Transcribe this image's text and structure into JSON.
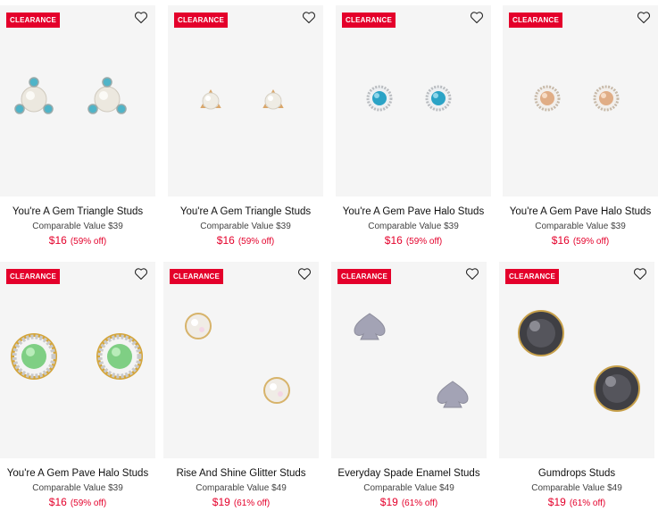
{
  "colors": {
    "accent": "#e4002b",
    "card_bg": "#f5f5f5"
  },
  "products": [
    {
      "badge": "CLEARANCE",
      "wishlist_icon": "heart-outline-icon",
      "name": "You're A Gem Triangle Studs",
      "comparable": "Comparable Value $39",
      "price": "$16",
      "discount": "(59% off)"
    },
    {
      "badge": "CLEARANCE",
      "wishlist_icon": "heart-outline-icon",
      "name": "You're A Gem Triangle Studs",
      "comparable": "Comparable Value $39",
      "price": "$16",
      "discount": "(59% off)"
    },
    {
      "badge": "CLEARANCE",
      "wishlist_icon": "heart-outline-icon",
      "name": "You're A Gem Pave Halo Studs",
      "comparable": "Comparable Value $39",
      "price": "$16",
      "discount": "(59% off)"
    },
    {
      "badge": "CLEARANCE",
      "wishlist_icon": "heart-outline-icon",
      "name": "You're A Gem Pave Halo Studs",
      "comparable": "Comparable Value $39",
      "price": "$16",
      "discount": "(59% off)"
    },
    {
      "badge": "CLEARANCE",
      "wishlist_icon": "heart-outline-icon",
      "name": "You're A Gem Pave Halo Studs",
      "comparable": "Comparable Value $39",
      "price": "$16",
      "discount": "(59% off)"
    },
    {
      "badge": "CLEARANCE",
      "wishlist_icon": "heart-outline-icon",
      "name": "Rise And Shine Glitter Studs",
      "comparable": "Comparable Value $49",
      "price": "$19",
      "discount": "(61% off)"
    },
    {
      "badge": "CLEARANCE",
      "wishlist_icon": "heart-outline-icon",
      "name": "Everyday Spade Enamel Studs",
      "comparable": "Comparable Value $49",
      "price": "$19",
      "discount": "(61% off)"
    },
    {
      "badge": "CLEARANCE",
      "wishlist_icon": "heart-outline-icon",
      "name": "Gumdrops Studs",
      "comparable": "Comparable Value $49",
      "price": "$19",
      "discount": "(61% off)"
    }
  ]
}
